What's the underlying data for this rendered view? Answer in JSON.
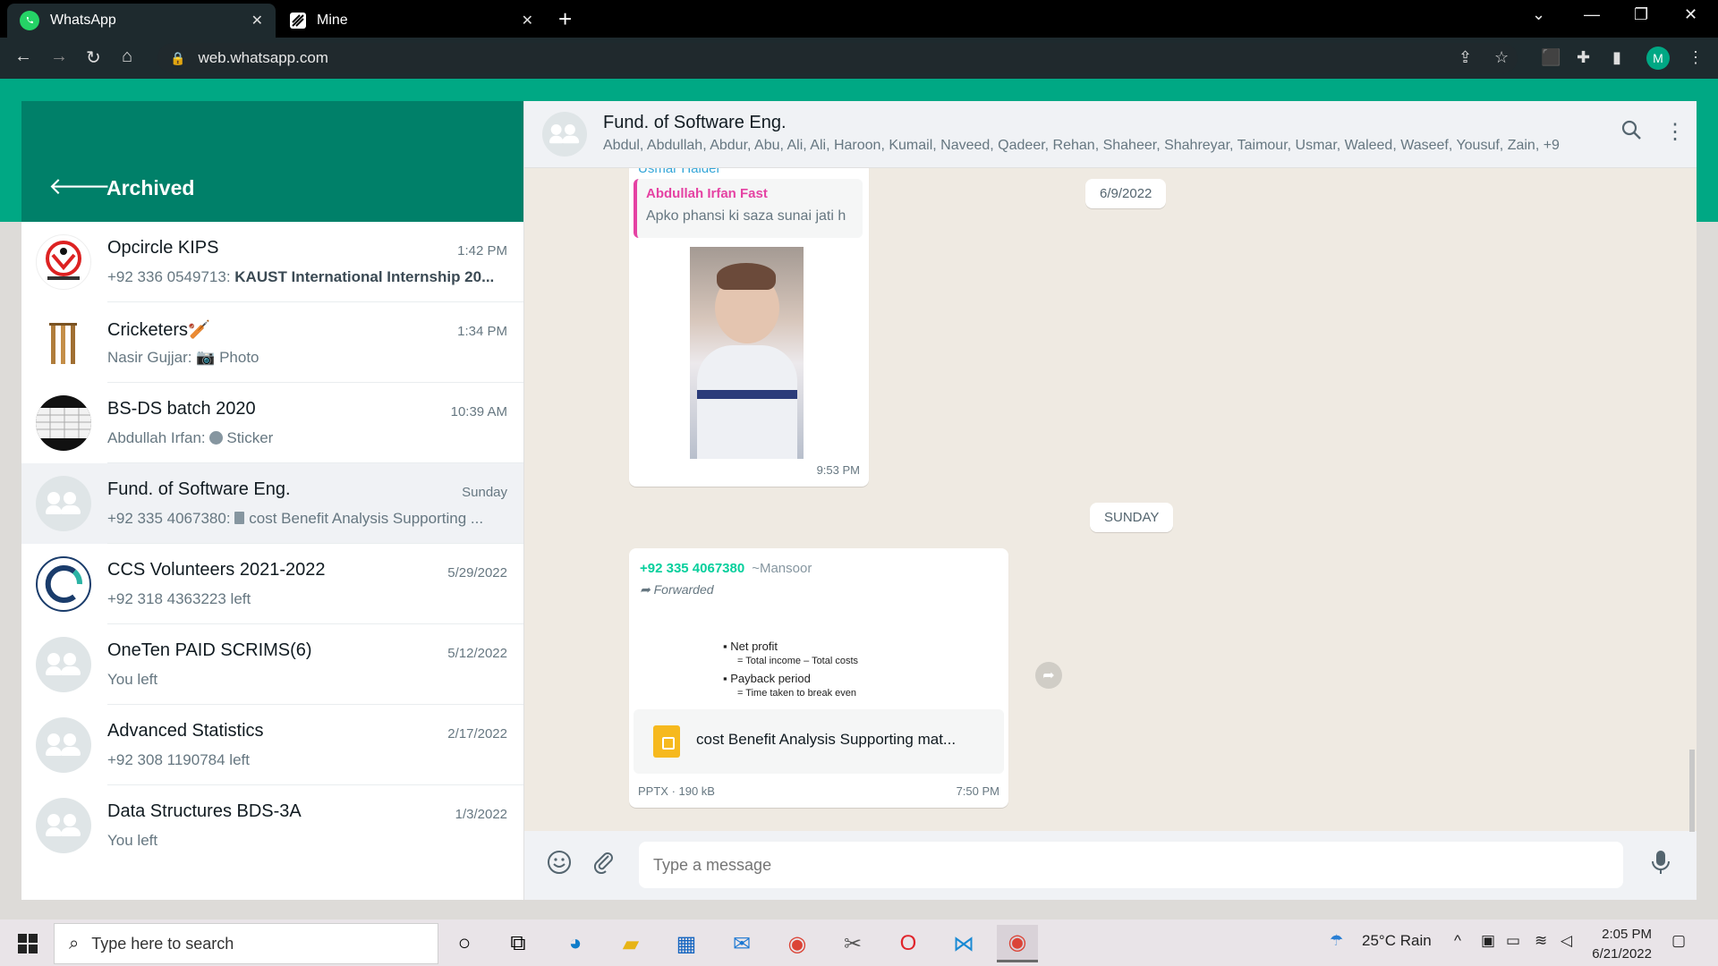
{
  "browser": {
    "tabs": [
      {
        "title": "WhatsApp",
        "active": true
      },
      {
        "title": "Mine",
        "active": false
      }
    ],
    "url": "web.whatsapp.com",
    "profile_initial": "M"
  },
  "sidebar": {
    "header_title": "Archived",
    "chats": [
      {
        "name": "Opcircle KIPS",
        "time": "1:42 PM",
        "preview_prefix": "+92 336 0549713: ",
        "preview_bold": "KAUST International Internship 20...",
        "preview": "",
        "selected": false
      },
      {
        "name": "Cricketers🏏",
        "time": "1:34 PM",
        "preview_prefix": "Nasir Gujjar: ",
        "preview_bold": "",
        "preview": "📷 Photo",
        "selected": false
      },
      {
        "name": "BS-DS batch 2020",
        "time": "10:39 AM",
        "preview_prefix": "Abdullah Irfan: ",
        "preview_bold": "",
        "preview": "Sticker",
        "selected": false
      },
      {
        "name": "Fund. of Software Eng.",
        "time": "Sunday",
        "preview_prefix": "+92 335 4067380: ",
        "preview_bold": "",
        "preview": "cost Benefit Analysis Supporting ...",
        "selected": true
      },
      {
        "name": "CCS Volunteers 2021-2022",
        "time": "5/29/2022",
        "preview_prefix": "",
        "preview_bold": "",
        "preview": "+92 318 4363223 left",
        "selected": false
      },
      {
        "name": "OneTen PAID SCRIMS(6)",
        "time": "5/12/2022",
        "preview_prefix": "",
        "preview_bold": "",
        "preview": "You left",
        "selected": false
      },
      {
        "name": "Advanced Statistics",
        "time": "2/17/2022",
        "preview_prefix": "",
        "preview_bold": "",
        "preview": "+92 308 1190784 left",
        "selected": false
      },
      {
        "name": "Data Structures BDS-3A",
        "time": "1/3/2022",
        "preview_prefix": "",
        "preview_bold": "",
        "preview": "You left",
        "selected": false
      }
    ]
  },
  "conversation": {
    "group_name": "Fund. of Software Eng.",
    "members": "Abdul, Abdullah, Abdur, Abu, Ali, Ali, Haroon, Kumail, Naveed, Qadeer, Rehan, Shaheer, Shahreyar, Taimour, Usmar, Waleed, Waseef, Yousuf, Zain, +9...",
    "date_chip_1": "6/9/2022",
    "date_chip_2": "SUNDAY",
    "msg1": {
      "sender": "Usmar Haider",
      "quote_name": "Abdullah Irfan Fast",
      "quote_text": "Apko phansi ki saza sunai jati h",
      "time": "9:53 PM"
    },
    "msg2": {
      "sender_phone": "+92 335 4067380",
      "sender_nick": "~Mansoor",
      "forwarded_label": "Forwarded",
      "slide_lines": [
        "Net profit",
        "= Total income – Total costs",
        "Payback period",
        "= Time taken to break even"
      ],
      "doc_name": "cost Benefit Analysis Supporting mat...",
      "doc_meta": "PPTX · 190 kB",
      "time": "7:50 PM"
    },
    "composer_placeholder": "Type a message"
  },
  "taskbar": {
    "search_placeholder": "Type here to search",
    "weather": "25°C  Rain",
    "time": "2:05 PM",
    "date": "6/21/2022"
  },
  "colors": {
    "whatsapp_green": "#00a884",
    "header_green": "#008069",
    "chat_bg": "#efeae2"
  }
}
